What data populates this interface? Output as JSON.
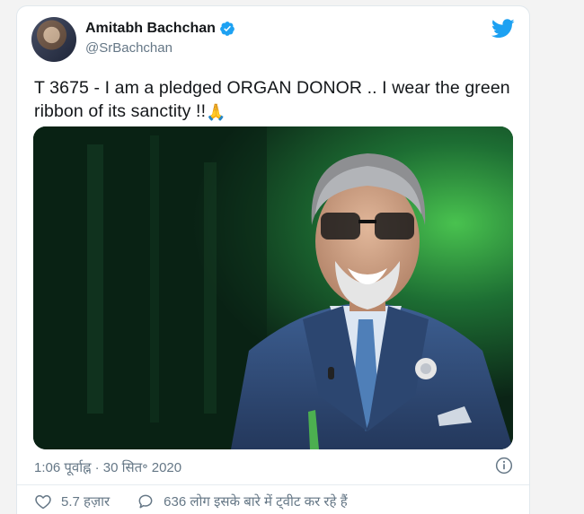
{
  "tweet": {
    "author": {
      "display_name": "Amitabh Bachchan",
      "handle": "@SrBachchan",
      "verified": true
    },
    "text": "T 3675 - I am a pledged ORGAN DONOR  .. I wear the green ribbon of its sanctity  !!",
    "text_emoji": "🙏",
    "timestamp": "1:06 पूर्वाह्न · 30 सित॰ 2020",
    "likes_label": "5.7 हज़ार",
    "discussion_label": "636 लोग इसके बारे में ट्वीट कर रहे हैं"
  },
  "colors": {
    "brand_blue": "#1da1f2",
    "secondary_text": "#657786",
    "primary_text": "#14171a"
  },
  "icons": {
    "bird": "twitter-bird-icon",
    "verified": "verified-badge-icon",
    "info": "info-icon",
    "like": "heart-icon",
    "reply": "speech-bubble-icon"
  }
}
